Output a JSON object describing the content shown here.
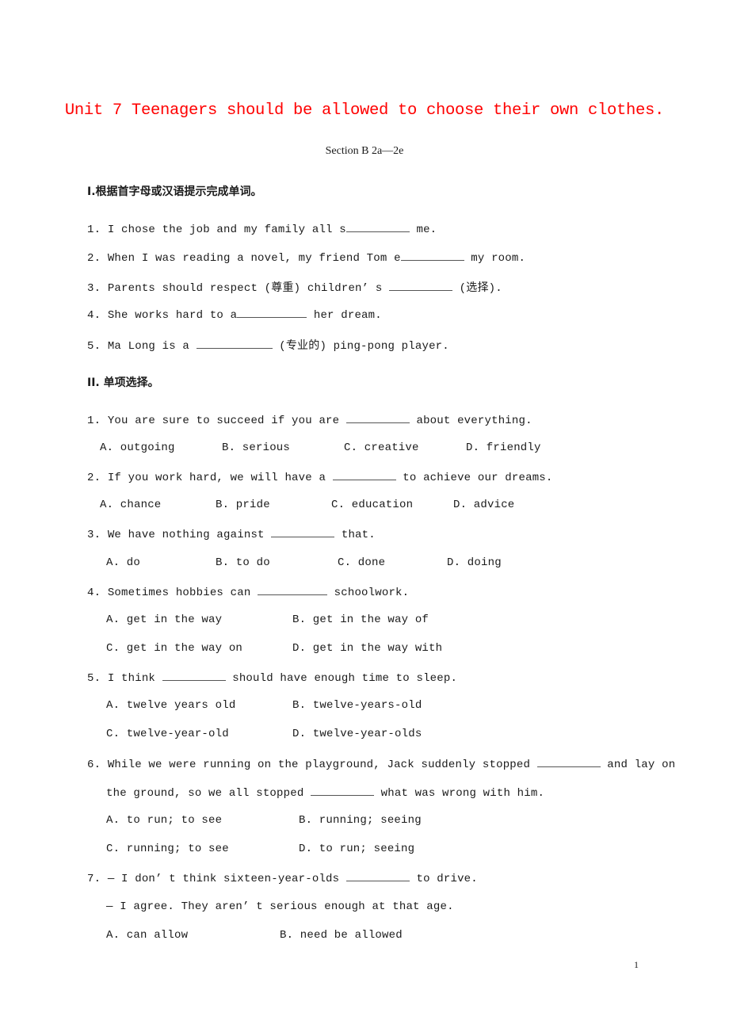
{
  "document": {
    "title": "Unit 7 Teenagers should be allowed to choose their own clothes.",
    "subtitle": "Section B 2a—2e",
    "page_number": "1",
    "title_color": "#ff0000"
  },
  "part1": {
    "heading": "I.根据首字母或汉语提示完成单词。",
    "items": [
      {
        "num": "1.",
        "before": "I chose the job and my family all s",
        "after": " me."
      },
      {
        "num": "2.",
        "before": "When I was reading a novel, my friend Tom e",
        "after": " my room."
      },
      {
        "num": "3.",
        "before": "Parents should respect (尊重) children’ s ",
        "after": " (选择)."
      },
      {
        "num": "4.",
        "before": "She works hard to a",
        "after": " her dream."
      },
      {
        "num": "5.",
        "before": "Ma Long is a ",
        "after": " (专业的) ping-pong player."
      }
    ]
  },
  "part2": {
    "heading": "II. 单项选择。",
    "questions": [
      {
        "num": "1.",
        "lines": [
          {
            "before": "You are sure to succeed if you are ",
            "after": " about everything."
          }
        ],
        "options": [
          "A. outgoing",
          "B. serious",
          "C. creative",
          "D. friendly"
        ]
      },
      {
        "num": "2.",
        "lines": [
          {
            "before": "If you work hard, we will have a ",
            "after": " to achieve our dreams."
          }
        ],
        "options": [
          "A. chance",
          "B. pride",
          "C. education",
          "D. advice"
        ]
      },
      {
        "num": "3.",
        "lines": [
          {
            "before": "We have nothing against ",
            "after": " that."
          }
        ],
        "options": [
          "A. do",
          "B. to do",
          "C. done",
          "D. doing"
        ]
      },
      {
        "num": "4.",
        "lines": [
          {
            "before": "Sometimes hobbies can ",
            "after": " schoolwork."
          }
        ],
        "options": [
          "A. get in the way",
          "B. get in the way of",
          "C. get in the way on",
          "D. get in the way with"
        ]
      },
      {
        "num": "5.",
        "lines": [
          {
            "before": "I think ",
            "after": " should have enough time to sleep."
          }
        ],
        "options": [
          "A. twelve years old",
          "B. twelve-years-old",
          "C. twelve-year-old",
          "D. twelve-year-olds"
        ]
      },
      {
        "num": "6.",
        "lines": [
          {
            "before": "While we were running on the playground, Jack suddenly stopped ",
            "after": " and lay on"
          },
          {
            "before": "the ground, so we all stopped ",
            "after": " what was wrong with him."
          }
        ],
        "options": [
          "A. to run; to see",
          "B. running; seeing",
          "C. running; to see",
          "D. to run; seeing"
        ]
      },
      {
        "num": "7.",
        "lines": [
          {
            "before": "— I don’ t think sixteen-year-olds ",
            "after": " to drive."
          },
          {
            "before": "— I agree. They aren’ t serious enough at that age.",
            "after": ""
          }
        ],
        "options": [
          "A. can allow",
          "B. need be allowed"
        ]
      }
    ]
  }
}
